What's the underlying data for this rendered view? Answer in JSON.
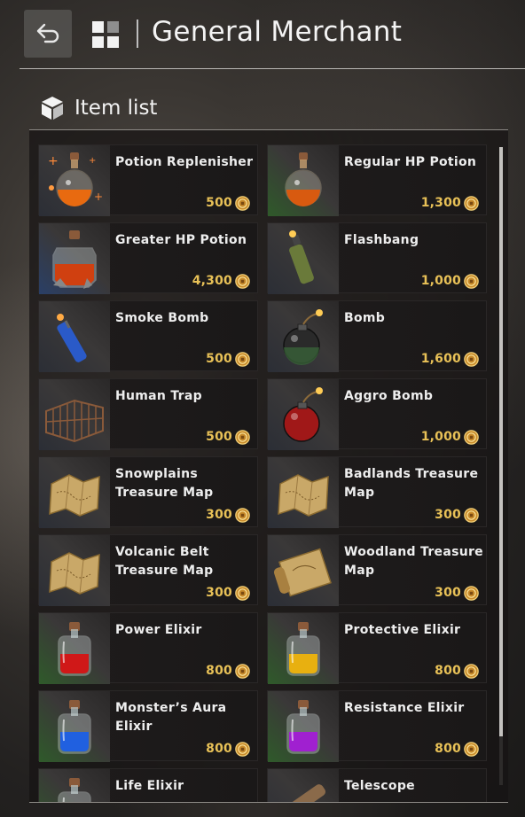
{
  "header": {
    "title": "General Merchant"
  },
  "section": {
    "title": "Item list"
  },
  "items": [
    {
      "name": "Potion Replenisher",
      "price": "500",
      "icon": "potion-replenisher-icon",
      "tint": "#2b2e36"
    },
    {
      "name": "Regular HP Potion",
      "price": "1,300",
      "icon": "regular-hp-potion-icon",
      "tint": "#2f5a2a"
    },
    {
      "name": "Greater HP Potion",
      "price": "4,300",
      "icon": "greater-hp-potion-icon",
      "tint": "#2a3f66"
    },
    {
      "name": "Flashbang",
      "price": "1,000",
      "icon": "flashbang-icon",
      "tint": "#2b2e36"
    },
    {
      "name": "Smoke Bomb",
      "price": "500",
      "icon": "smoke-bomb-icon",
      "tint": "#2b2e36"
    },
    {
      "name": "Bomb",
      "price": "1,600",
      "icon": "bomb-icon",
      "tint": "#2b2e36"
    },
    {
      "name": "Human Trap",
      "price": "500",
      "icon": "human-trap-icon",
      "tint": "#2b2e36"
    },
    {
      "name": "Aggro Bomb",
      "price": "1,000",
      "icon": "aggro-bomb-icon",
      "tint": "#2b2e36"
    },
    {
      "name": "Snowplains Treasure Map",
      "price": "300",
      "icon": "treasure-map-icon",
      "tint": "#2b2e36"
    },
    {
      "name": "Badlands Treasure Map",
      "price": "300",
      "icon": "treasure-map-icon",
      "tint": "#2b2e36"
    },
    {
      "name": "Volcanic Belt Treasure Map",
      "price": "300",
      "icon": "treasure-map-icon",
      "tint": "#2b2e36"
    },
    {
      "name": "Woodland Treasure Map",
      "price": "300",
      "icon": "treasure-map-scroll-icon",
      "tint": "#2b2e36"
    },
    {
      "name": "Power Elixir",
      "price": "800",
      "icon": "power-elixir-icon",
      "tint": "#2f5a2a"
    },
    {
      "name": "Protective Elixir",
      "price": "800",
      "icon": "protective-elixir-icon",
      "tint": "#2f5a2a"
    },
    {
      "name": "Monster’s Aura Elixir",
      "price": "800",
      "icon": "monster-aura-elixir-icon",
      "tint": "#2f5a2a"
    },
    {
      "name": "Resistance Elixir",
      "price": "800",
      "icon": "resistance-elixir-icon",
      "tint": "#2f5a2a"
    },
    {
      "name": "Life Elixir",
      "price": "",
      "icon": "life-elixir-icon",
      "tint": "#2f5a2a"
    },
    {
      "name": "Telescope",
      "price": "",
      "icon": "telescope-icon",
      "tint": "#2b2e36"
    }
  ],
  "colors": {
    "price": "#e8c157",
    "accent_line": "#b9b7b4"
  }
}
